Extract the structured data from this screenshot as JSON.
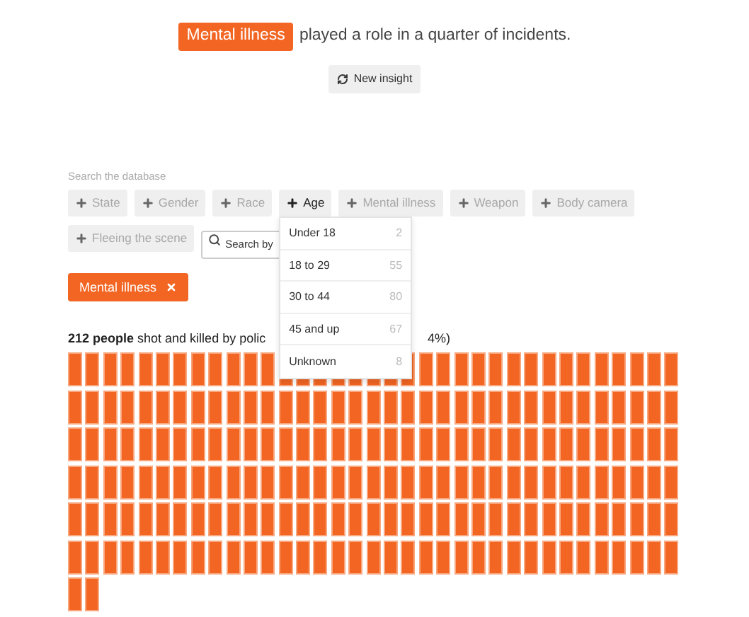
{
  "insight": {
    "tag": "Mental illness",
    "text": "played a role in a quarter of incidents.",
    "button": "New insight"
  },
  "search": {
    "label": "Search the database",
    "placeholder": "Search by"
  },
  "filters": [
    {
      "label": "State",
      "selected": false
    },
    {
      "label": "Gender",
      "selected": false
    },
    {
      "label": "Race",
      "selected": false
    },
    {
      "label": "Age",
      "selected": true
    },
    {
      "label": "Mental illness",
      "selected": false
    },
    {
      "label": "Weapon",
      "selected": false
    },
    {
      "label": "Body camera",
      "selected": false
    },
    {
      "label": "Fleeing the scene",
      "selected": false
    }
  ],
  "active_filters": [
    {
      "label": "Mental illness"
    }
  ],
  "age_menu": [
    {
      "label": "Under 18",
      "count": "2"
    },
    {
      "label": "18 to 29",
      "count": "55"
    },
    {
      "label": "30 to 44",
      "count": "80"
    },
    {
      "label": "45 and up",
      "count": "67"
    },
    {
      "label": "Unknown",
      "count": "8"
    }
  ],
  "result": {
    "text": "**212 people** shot and killed by polic",
    "tail": "4%)"
  }
}
